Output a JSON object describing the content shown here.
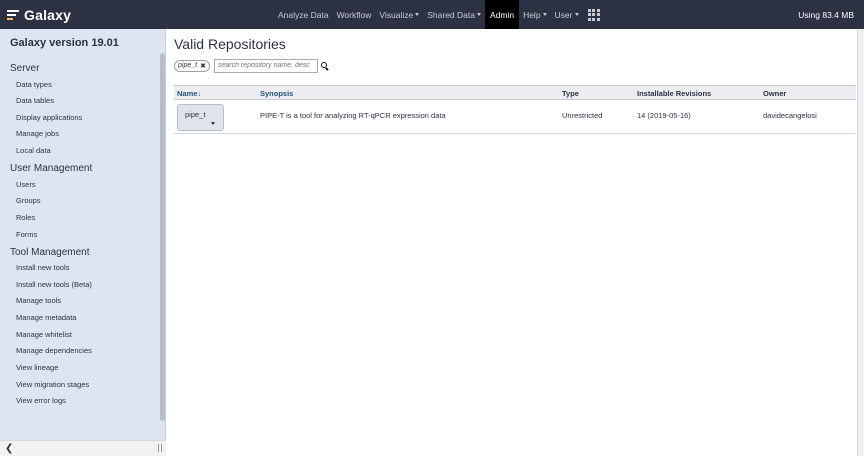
{
  "brand": {
    "name": "Galaxy"
  },
  "navbar": {
    "items": [
      {
        "label": "Analyze Data",
        "dropdown": false
      },
      {
        "label": "Workflow",
        "dropdown": false
      },
      {
        "label": "Visualize",
        "dropdown": true
      },
      {
        "label": "Shared Data",
        "dropdown": true
      },
      {
        "label": "Admin",
        "dropdown": false,
        "active": true
      },
      {
        "label": "Help",
        "dropdown": true
      },
      {
        "label": "User",
        "dropdown": true
      }
    ],
    "apps_icon": "grid-icon",
    "usage": "Using 83.4 MB"
  },
  "left_panel": {
    "title": "Galaxy version 19.01",
    "sections": [
      {
        "title": "Server",
        "links": [
          "Data types",
          "Data tables",
          "Display applications",
          "Manage jobs",
          "Local data"
        ]
      },
      {
        "title": "User Management",
        "links": [
          "Users",
          "Groups",
          "Roles",
          "Forms"
        ]
      },
      {
        "title": "Tool Management",
        "links": [
          "Install new tools",
          "Install new tools (Beta)",
          "Manage tools",
          "Manage metadata",
          "Manage whitelist",
          "Manage dependencies",
          "View lineage",
          "View migration stages",
          "View error logs"
        ]
      }
    ],
    "collapse_icon": "chevron-left-icon"
  },
  "main": {
    "title": "Valid Repositories",
    "filter": {
      "value": "pipe_t",
      "remove_icon": "close-icon"
    },
    "search": {
      "placeholder": "search repository name, desc",
      "icon": "search-icon"
    },
    "table": {
      "headers": [
        "Name↓",
        "Synopsis",
        "Type",
        "Installable Revisions",
        "Owner"
      ],
      "rows": [
        {
          "name": "pipe_t",
          "synopsis": "PIPE-T is a tool for analyzing RT-qPCR expression data",
          "type": "Unrestricted",
          "revisions": "14 (2019-05-16)",
          "owner": "davidecangelosi"
        }
      ]
    }
  },
  "colors": {
    "navbar": "#2c3143",
    "left_panel": "#dfe5f0",
    "active_nav": "#000000",
    "link": "#25537b"
  }
}
